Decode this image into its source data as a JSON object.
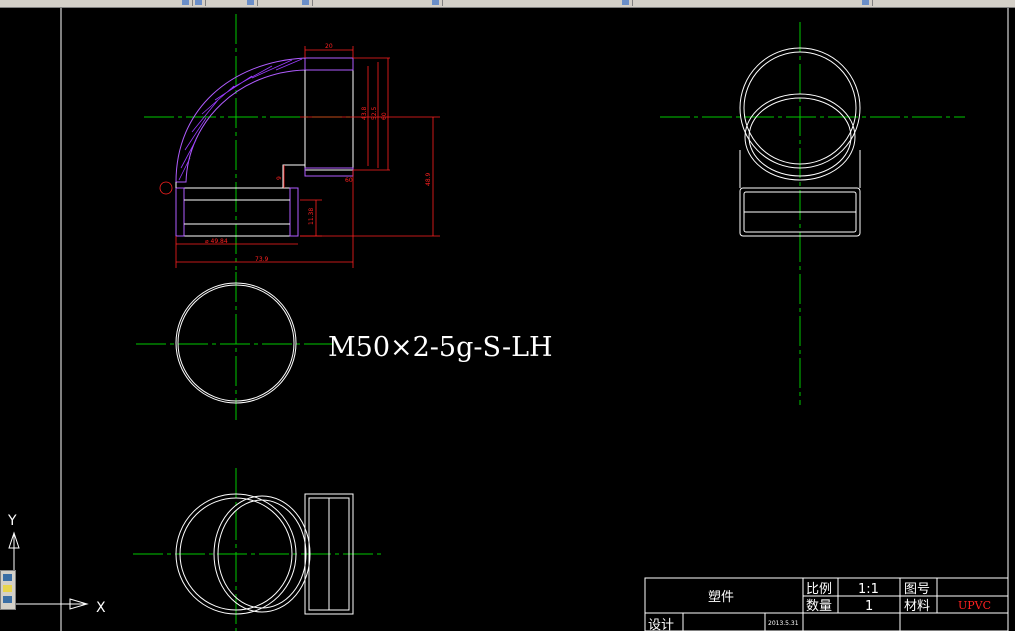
{
  "toolbar": {
    "icons": [
      "layer-icon",
      "properties-icon",
      "match-icon",
      "zoom-icon",
      "pan-icon",
      "print-icon",
      "help-icon"
    ]
  },
  "dims": {
    "d20": "20",
    "d489": "48.9",
    "d9": "9",
    "d1138": "11.38",
    "d4984": "⌀ 49.84",
    "d739": "73.9",
    "dv1": "43.8",
    "dv2": "52.5",
    "dv3": "60"
  },
  "thread_note": "M50×2-5g-S-LH",
  "ucs": {
    "y": "Y",
    "x": "X"
  },
  "title_block": {
    "part_name": "塑件",
    "scale_label": "比例",
    "scale_value": "1:1",
    "drawing_no_label": "图号",
    "qty_label": "数量",
    "qty_value": "1",
    "material_label": "材料",
    "material_value": "UPVC",
    "design_label": "设计",
    "date": "2013.5.31"
  },
  "colors": {
    "background": "#000000",
    "outline": "#ffffff",
    "center_line": "#00c800",
    "dimension": "#ff2020",
    "hatch": "#8a2be2",
    "material": "#ff2020"
  }
}
